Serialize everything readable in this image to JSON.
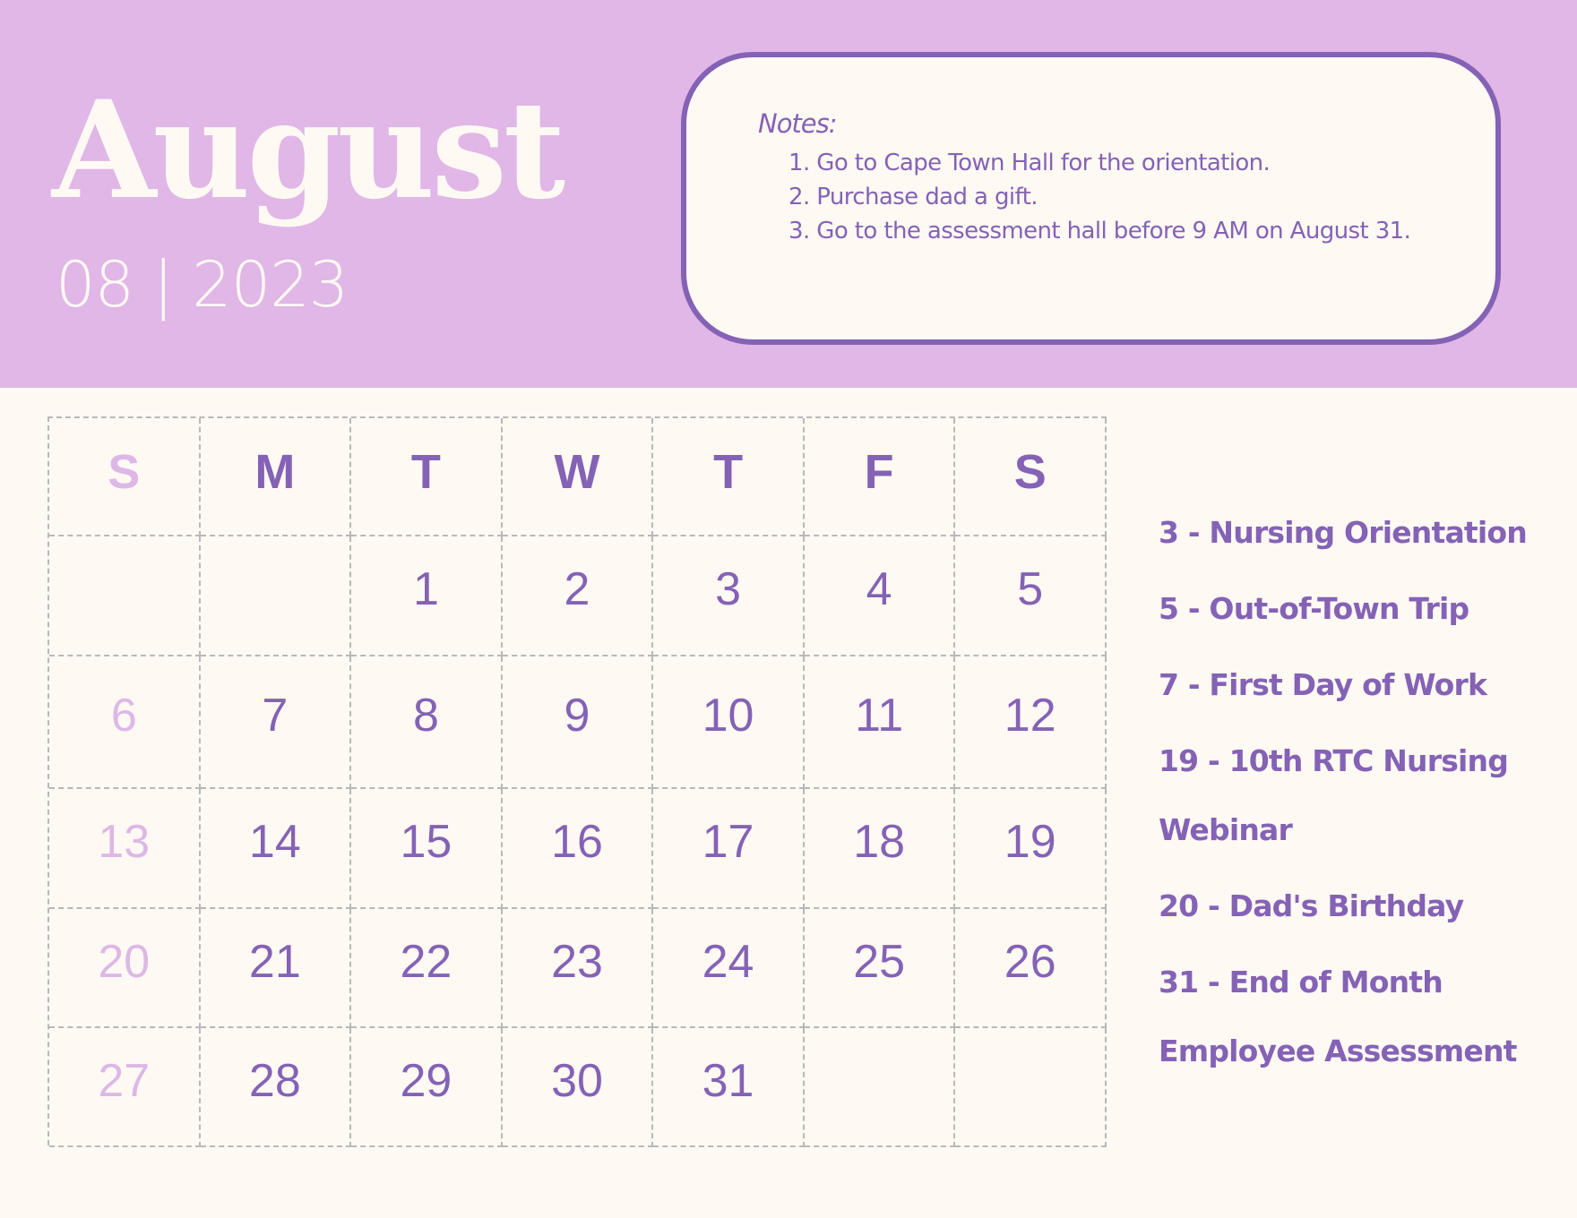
{
  "colors": {
    "header_bg": "#E0B7E6",
    "page_bg": "#FFF9F4",
    "accent": "#8462B5",
    "sunday": "#DDB8E6",
    "gridline": "#B8B8B8"
  },
  "header": {
    "month": "August",
    "month_year": "08 | 2023"
  },
  "notes": {
    "title": "Notes:",
    "items": [
      "1. Go to Cape Town Hall for the orientation.",
      "2. Purchase dad a gift.",
      "3. Go to the assessment hall before 9 AM on August 31."
    ]
  },
  "calendar": {
    "weekdays": [
      "S",
      "M",
      "T",
      "W",
      "T",
      "F",
      "S"
    ],
    "weeks": [
      [
        "",
        "",
        "1",
        "2",
        "3",
        "4",
        "5"
      ],
      [
        "6",
        "7",
        "8",
        "9",
        "10",
        "11",
        "12"
      ],
      [
        "13",
        "14",
        "15",
        "16",
        "17",
        "18",
        "19"
      ],
      [
        "20",
        "21",
        "22",
        "23",
        "24",
        "25",
        "26"
      ],
      [
        "27",
        "28",
        "29",
        "30",
        "31",
        "",
        ""
      ]
    ]
  },
  "events": [
    "3 - Nursing Orientation",
    "5 - Out-of-Town Trip",
    "7 - First Day of Work",
    "19 - 10th RTC Nursing Webinar",
    "20 - Dad's Birthday",
    "31 - End of Month Employee Assessment"
  ]
}
